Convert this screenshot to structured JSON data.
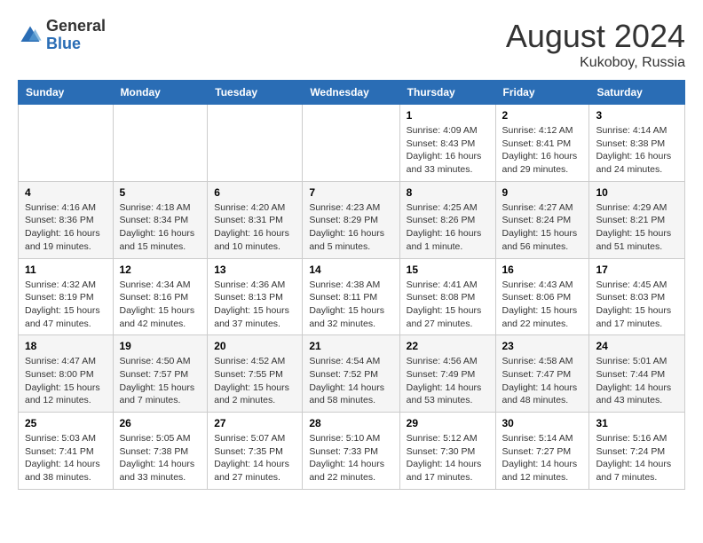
{
  "header": {
    "logo_general": "General",
    "logo_blue": "Blue",
    "month_year": "August 2024",
    "location": "Kukoboy, Russia"
  },
  "days_of_week": [
    "Sunday",
    "Monday",
    "Tuesday",
    "Wednesday",
    "Thursday",
    "Friday",
    "Saturday"
  ],
  "weeks": [
    [
      {
        "day": "",
        "info": ""
      },
      {
        "day": "",
        "info": ""
      },
      {
        "day": "",
        "info": ""
      },
      {
        "day": "",
        "info": ""
      },
      {
        "day": "1",
        "info": "Sunrise: 4:09 AM\nSunset: 8:43 PM\nDaylight: 16 hours\nand 33 minutes."
      },
      {
        "day": "2",
        "info": "Sunrise: 4:12 AM\nSunset: 8:41 PM\nDaylight: 16 hours\nand 29 minutes."
      },
      {
        "day": "3",
        "info": "Sunrise: 4:14 AM\nSunset: 8:38 PM\nDaylight: 16 hours\nand 24 minutes."
      }
    ],
    [
      {
        "day": "4",
        "info": "Sunrise: 4:16 AM\nSunset: 8:36 PM\nDaylight: 16 hours\nand 19 minutes."
      },
      {
        "day": "5",
        "info": "Sunrise: 4:18 AM\nSunset: 8:34 PM\nDaylight: 16 hours\nand 15 minutes."
      },
      {
        "day": "6",
        "info": "Sunrise: 4:20 AM\nSunset: 8:31 PM\nDaylight: 16 hours\nand 10 minutes."
      },
      {
        "day": "7",
        "info": "Sunrise: 4:23 AM\nSunset: 8:29 PM\nDaylight: 16 hours\nand 5 minutes."
      },
      {
        "day": "8",
        "info": "Sunrise: 4:25 AM\nSunset: 8:26 PM\nDaylight: 16 hours\nand 1 minute."
      },
      {
        "day": "9",
        "info": "Sunrise: 4:27 AM\nSunset: 8:24 PM\nDaylight: 15 hours\nand 56 minutes."
      },
      {
        "day": "10",
        "info": "Sunrise: 4:29 AM\nSunset: 8:21 PM\nDaylight: 15 hours\nand 51 minutes."
      }
    ],
    [
      {
        "day": "11",
        "info": "Sunrise: 4:32 AM\nSunset: 8:19 PM\nDaylight: 15 hours\nand 47 minutes."
      },
      {
        "day": "12",
        "info": "Sunrise: 4:34 AM\nSunset: 8:16 PM\nDaylight: 15 hours\nand 42 minutes."
      },
      {
        "day": "13",
        "info": "Sunrise: 4:36 AM\nSunset: 8:13 PM\nDaylight: 15 hours\nand 37 minutes."
      },
      {
        "day": "14",
        "info": "Sunrise: 4:38 AM\nSunset: 8:11 PM\nDaylight: 15 hours\nand 32 minutes."
      },
      {
        "day": "15",
        "info": "Sunrise: 4:41 AM\nSunset: 8:08 PM\nDaylight: 15 hours\nand 27 minutes."
      },
      {
        "day": "16",
        "info": "Sunrise: 4:43 AM\nSunset: 8:06 PM\nDaylight: 15 hours\nand 22 minutes."
      },
      {
        "day": "17",
        "info": "Sunrise: 4:45 AM\nSunset: 8:03 PM\nDaylight: 15 hours\nand 17 minutes."
      }
    ],
    [
      {
        "day": "18",
        "info": "Sunrise: 4:47 AM\nSunset: 8:00 PM\nDaylight: 15 hours\nand 12 minutes."
      },
      {
        "day": "19",
        "info": "Sunrise: 4:50 AM\nSunset: 7:57 PM\nDaylight: 15 hours\nand 7 minutes."
      },
      {
        "day": "20",
        "info": "Sunrise: 4:52 AM\nSunset: 7:55 PM\nDaylight: 15 hours\nand 2 minutes."
      },
      {
        "day": "21",
        "info": "Sunrise: 4:54 AM\nSunset: 7:52 PM\nDaylight: 14 hours\nand 58 minutes."
      },
      {
        "day": "22",
        "info": "Sunrise: 4:56 AM\nSunset: 7:49 PM\nDaylight: 14 hours\nand 53 minutes."
      },
      {
        "day": "23",
        "info": "Sunrise: 4:58 AM\nSunset: 7:47 PM\nDaylight: 14 hours\nand 48 minutes."
      },
      {
        "day": "24",
        "info": "Sunrise: 5:01 AM\nSunset: 7:44 PM\nDaylight: 14 hours\nand 43 minutes."
      }
    ],
    [
      {
        "day": "25",
        "info": "Sunrise: 5:03 AM\nSunset: 7:41 PM\nDaylight: 14 hours\nand 38 minutes."
      },
      {
        "day": "26",
        "info": "Sunrise: 5:05 AM\nSunset: 7:38 PM\nDaylight: 14 hours\nand 33 minutes."
      },
      {
        "day": "27",
        "info": "Sunrise: 5:07 AM\nSunset: 7:35 PM\nDaylight: 14 hours\nand 27 minutes."
      },
      {
        "day": "28",
        "info": "Sunrise: 5:10 AM\nSunset: 7:33 PM\nDaylight: 14 hours\nand 22 minutes."
      },
      {
        "day": "29",
        "info": "Sunrise: 5:12 AM\nSunset: 7:30 PM\nDaylight: 14 hours\nand 17 minutes."
      },
      {
        "day": "30",
        "info": "Sunrise: 5:14 AM\nSunset: 7:27 PM\nDaylight: 14 hours\nand 12 minutes."
      },
      {
        "day": "31",
        "info": "Sunrise: 5:16 AM\nSunset: 7:24 PM\nDaylight: 14 hours\nand 7 minutes."
      }
    ]
  ]
}
